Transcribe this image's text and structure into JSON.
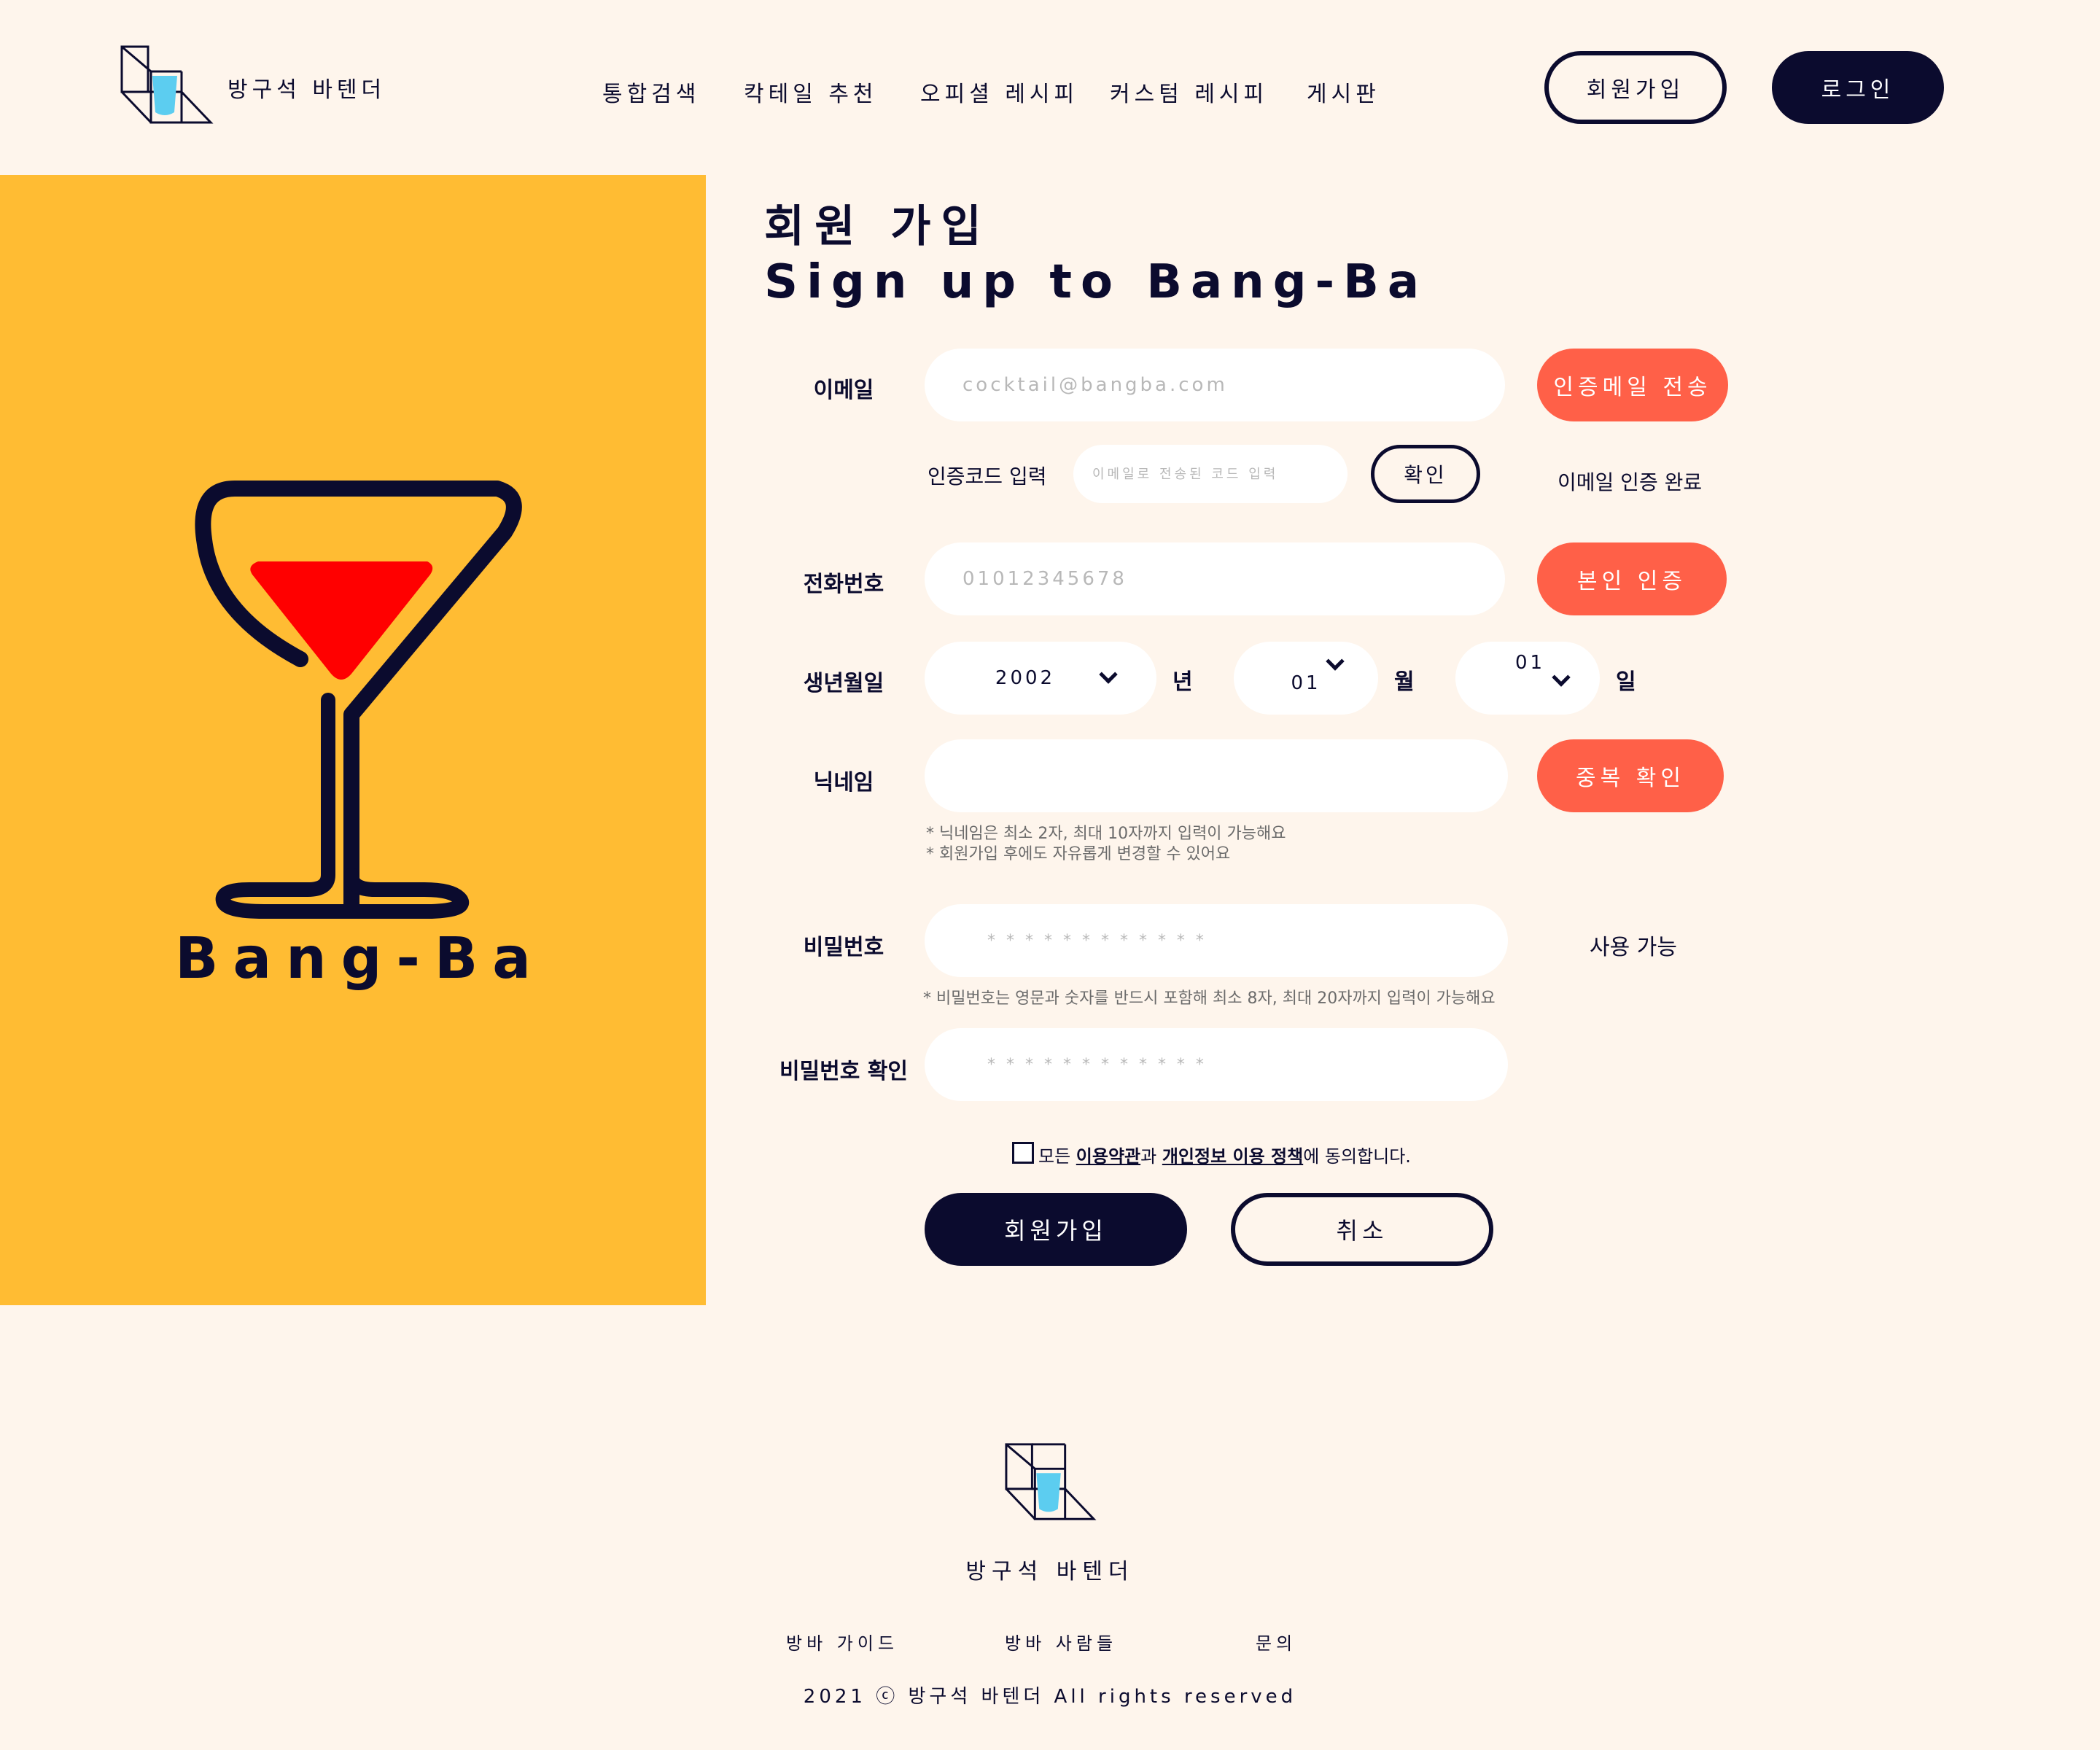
{
  "header": {
    "brand": "방구석 바텐더",
    "nav": [
      "통합검색",
      "칵테일 추천",
      "오피셜 레시피",
      "커스텀 레시피",
      "게시판"
    ],
    "signup_label": "회원가입",
    "login_label": "로그인"
  },
  "hero": {
    "brand": "Bang-Ba",
    "bg_color": "#ffbc33"
  },
  "form": {
    "title_ko": "회원 가입",
    "title_en": "Sign up to Bang-Ba",
    "email": {
      "label": "이메일",
      "placeholder": "cocktail@bangba.com",
      "send_button": "인증메일 전송"
    },
    "auth_code": {
      "label": "인증코드 입력",
      "placeholder": "이메일로 전송된 코드 입력",
      "confirm_button": "확인",
      "status": "이메일 인증 완료"
    },
    "phone": {
      "label": "전화번호",
      "placeholder": "01012345678",
      "verify_button": "본인 인증"
    },
    "birth": {
      "label": "생년월일",
      "year": "2002",
      "year_unit": "년",
      "month": "01",
      "month_unit": "월",
      "day": "01",
      "day_unit": "일"
    },
    "nickname": {
      "label": "닉네임",
      "value": "",
      "check_button": "중복 확인",
      "help_1": "* 닉네임은 최소 2자, 최대 10자까지 입력이 가능해요",
      "help_2": "* 회원가입 후에도 자유롭게 변경할 수 있어요"
    },
    "password": {
      "label": "비밀번호",
      "placeholder": "* * * * * * * * * * * *",
      "status": "사용 가능",
      "help": "* 비밀번호는 영문과 숫자를 반드시 포함해 최소 8자, 최대 20자까지 입력이 가능해요"
    },
    "password_confirm": {
      "label": "비밀번호 확인",
      "placeholder": "* * * * * * * * * * * *"
    },
    "agree": {
      "prefix": "모든 ",
      "terms": "이용약관",
      "middle": "과 ",
      "privacy": "개인정보 이용 정책",
      "suffix": "에 동의합니다."
    },
    "submit_label": "회원가입",
    "cancel_label": "취소"
  },
  "footer": {
    "brand": "방구석 바텐더",
    "links": [
      "방바 가이드",
      "방바 사람들",
      "문의"
    ],
    "copyright": "2021 ⓒ 방구석 바텐더 All rights reserved"
  },
  "colors": {
    "background": "#fef5ec",
    "navy": "#0b0b2e",
    "coral": "#ff6048",
    "yellow": "#ffbc33",
    "red": "#ff0000",
    "cup_blue": "#5ccdf0"
  },
  "icons": {
    "logo": "cube-cup-icon",
    "glass": "cocktail-glass-icon",
    "dropdown": "chevron-down-icon"
  }
}
